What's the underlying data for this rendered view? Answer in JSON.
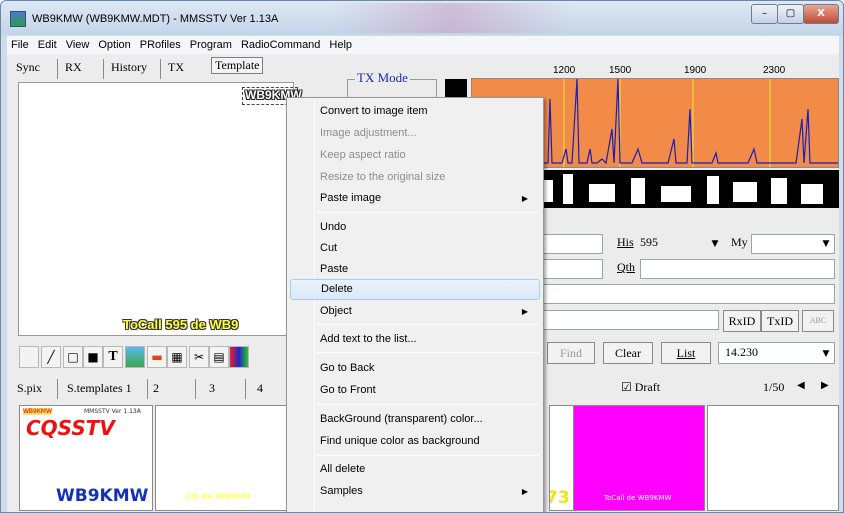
{
  "window": {
    "title": "WB9KMW (WB9KMW.MDT) - MMSSTV Ver 1.13A",
    "caption_buttons": {
      "minimize": "–",
      "maximize": "▢",
      "close": "X"
    }
  },
  "menu": [
    "File",
    "Edit",
    "View",
    "Option",
    "PRofiles",
    "Program",
    "RadioCommand",
    "Help"
  ],
  "top_tabs": [
    "Sync",
    "RX",
    "History",
    "TX",
    "Template"
  ],
  "canvas": {
    "callsign_text": "WB9KMW",
    "tocall_text": "ToCall 595 de WB9"
  },
  "tx_mode_label": "TX Mode",
  "freq_scale": [
    "1200",
    "1500",
    "1900",
    "2300"
  ],
  "qso": {
    "his_label": "His",
    "his_value": "595",
    "my_label": "My",
    "qth_label": "Qth"
  },
  "buttons": {
    "rxid": "RxID",
    "txid": "TxID",
    "find": "Find",
    "clear": "Clear",
    "list": "List",
    "abc": "ABC"
  },
  "frequency": "14.230",
  "bottom_tabs": [
    "S.pix",
    "S.templates 1",
    "2",
    "3",
    "4"
  ],
  "draft": {
    "label": "Draft",
    "checked": true
  },
  "page_counter": "1/50",
  "thumbs": [
    {
      "top_left": "WB9KMW",
      "top_right": "MMSSTV Ver 1.13A",
      "big": "CQSSTV",
      "bottom": "WB9KMW"
    },
    {
      "bottom": "CQ de WB9KM"
    },
    {
      "big": "73",
      "bottom": "ToCall de WB9KMW"
    }
  ],
  "context_menu": [
    {
      "label": "Convert to image item",
      "state": "normal"
    },
    {
      "label": "Image adjustment...",
      "state": "disabled"
    },
    {
      "label": "Keep aspect ratio",
      "state": "disabled"
    },
    {
      "label": "Resize to the original size",
      "state": "disabled"
    },
    {
      "label": "Paste image",
      "state": "submenu"
    },
    {
      "label": "Undo",
      "state": "normal"
    },
    {
      "label": "Cut",
      "state": "normal"
    },
    {
      "label": "Paste",
      "state": "normal"
    },
    {
      "label": "Delete",
      "state": "highlighted"
    },
    {
      "label": "Object",
      "state": "submenu"
    },
    {
      "label": "Add text to the list...",
      "state": "normal"
    },
    {
      "label": "Go to Back",
      "state": "normal"
    },
    {
      "label": "Go to Front",
      "state": "normal"
    },
    {
      "label": "BackGround (transparent) color...",
      "state": "normal"
    },
    {
      "label": "Find unique color as background",
      "state": "normal"
    },
    {
      "label": "All delete",
      "state": "normal"
    },
    {
      "label": "Samples",
      "state": "submenu"
    }
  ],
  "colors": {
    "spectrum_bg": "#f28a48",
    "spectrum_line": "#1b1fb8",
    "marker_line": "#e8e83c",
    "highlight": "#dbe9f7",
    "magenta_thumb": "#ff00ff"
  }
}
